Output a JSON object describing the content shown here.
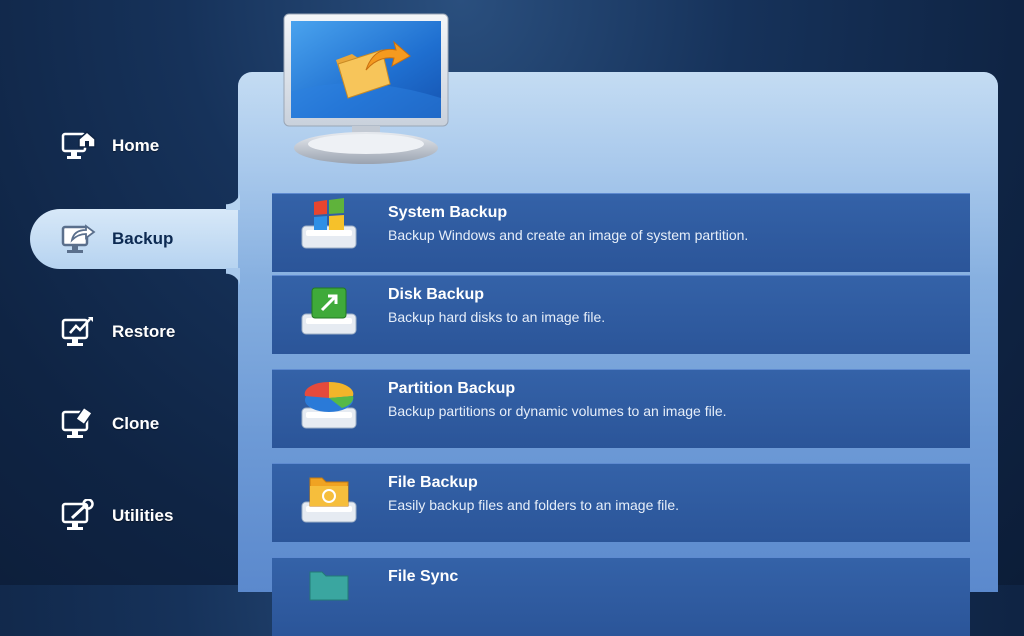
{
  "sidebar": {
    "items": [
      {
        "label": "Home",
        "icon": "home-icon"
      },
      {
        "label": "Backup",
        "icon": "backup-icon",
        "active": true
      },
      {
        "label": "Restore",
        "icon": "restore-icon"
      },
      {
        "label": "Clone",
        "icon": "clone-icon"
      },
      {
        "label": "Utilities",
        "icon": "utilities-icon"
      }
    ]
  },
  "main": {
    "options": [
      {
        "title": "System Backup",
        "description": "Backup Windows and create an image of system partition.",
        "icon": "windows-logo-icon"
      },
      {
        "title": "Disk Backup",
        "description": "Backup hard disks to an image file.",
        "icon": "disk-icon"
      },
      {
        "title": "Partition Backup",
        "description": "Backup partitions or dynamic volumes to an image file.",
        "icon": "pie-chart-icon"
      },
      {
        "title": "File Backup",
        "description": "Easily backup files and folders to an image file.",
        "icon": "folder-icon"
      },
      {
        "title": "File Sync",
        "description": "",
        "icon": "sync-folder-icon"
      }
    ]
  },
  "colors": {
    "background": "#132b50",
    "panel": "#87b0e0",
    "option": "#3462a8",
    "active_tab": "#c6def5"
  }
}
